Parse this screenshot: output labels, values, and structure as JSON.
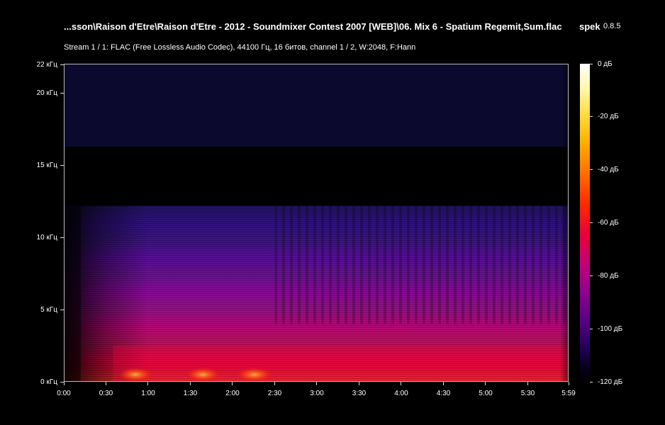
{
  "header": {
    "file_title": "...sson\\Raison d'Etre\\Raison d'Etre - 2012 - Soundmixer Contest 2007 [WEB]\\06. Mix 6 - Spatium Regemit,Sum.flac",
    "app_name": "spek",
    "app_version": "0.8.5",
    "stream_info": "Stream 1 / 1: FLAC (Free Lossless Audio Codec), 44100 Гц, 16 битов, channel 1 / 2, W:2048, F:Hann"
  },
  "chart_data": {
    "type": "heatmap",
    "title": "...sson\\Raison d'Etre\\Raison d'Etre - 2012 - Soundmixer Contest 2007 [WEB]\\06. Mix 6 - Spatium Regemit,Sum.flac",
    "subtitle": "Stream 1 / 1: FLAC (Free Lossless Audio Codec), 44100 Гц, 16 битов, channel 1 / 2, W:2048, F:Hann",
    "x_tick_labels": [
      "0:00",
      "0:30",
      "1:00",
      "1:30",
      "2:00",
      "2:30",
      "3:00",
      "3:30",
      "4:00",
      "4:30",
      "5:00",
      "5:30",
      "5:59"
    ],
    "x_tick_seconds": [
      0,
      30,
      60,
      90,
      120,
      150,
      180,
      210,
      240,
      270,
      300,
      330,
      359
    ],
    "xlim_seconds": [
      0,
      359
    ],
    "y_tick_labels": [
      "0 кГц",
      "5 кГц",
      "10 кГц",
      "15 кГц",
      "20 кГц",
      "22 кГц"
    ],
    "y_tick_khz": [
      0,
      5,
      10,
      15,
      20,
      22
    ],
    "ylim_khz": [
      0,
      22.05
    ],
    "colorbar": {
      "tick_labels": [
        "0 дБ",
        "-20 дБ",
        "-40 дБ",
        "-60 дБ",
        "-80 дБ",
        "-100 дБ",
        "-120 дБ"
      ],
      "tick_db": [
        0,
        -20,
        -40,
        -60,
        -80,
        -100,
        -120
      ],
      "range_db": [
        -120,
        0
      ]
    },
    "approx_features": {
      "noise_floor_band_khz": [
        16.3,
        22.05
      ],
      "noise_floor_db": -108,
      "empty_band_khz": [
        12.5,
        16.3
      ],
      "content_cutoff_khz": 12.2,
      "content_start_seconds": 12,
      "bright_low_freq_bursts_seconds": [
        [
          42,
          60
        ],
        [
          90,
          108
        ],
        [
          126,
          145
        ]
      ],
      "dominant_energy_band_khz": [
        0,
        2.5
      ]
    }
  },
  "colors": {
    "background": "#000000",
    "text": "#ffffff",
    "frame": "#bbbbbb",
    "noise_floor": "#0b0a2e",
    "high_freq_content": "#2b1670",
    "mid_freq_content": "#8e0f99",
    "low_freq_content": "#e20a3a",
    "hot_spots": "#ff7a1a"
  }
}
